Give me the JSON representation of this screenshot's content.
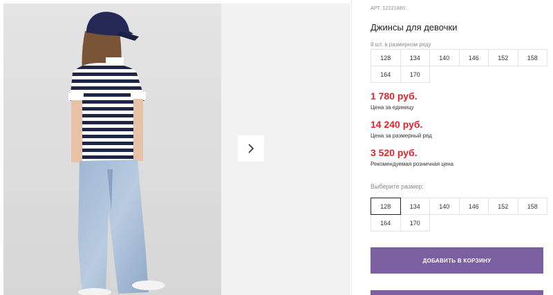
{
  "product": {
    "article": "АРТ. 12221880",
    "title": "Джинсы для девочки",
    "pack_note": "8 шт. в размерном ряду",
    "pack_sizes": [
      "128",
      "134",
      "140",
      "146",
      "152",
      "158",
      "164",
      "170"
    ]
  },
  "prices": [
    {
      "value": "1 780 руб.",
      "label": "Цена за единицу"
    },
    {
      "value": "14 240 руб.",
      "label": "Цена за размерный ряд"
    },
    {
      "value": "3 520 руб.",
      "label": "Рекомендуемая розничная цена"
    }
  ],
  "size_selector": {
    "label": "Выберите размер:",
    "sizes": [
      "128",
      "134",
      "140",
      "146",
      "152",
      "158",
      "164",
      "170"
    ],
    "selected": "128"
  },
  "actions": {
    "add_to_cart": "ДОБАВИТЬ В КОРЗИНУ"
  },
  "gallery": {
    "next_icon": "chevron-right-icon"
  },
  "colors": {
    "accent": "#7a60a0",
    "price": "#e2232e"
  }
}
